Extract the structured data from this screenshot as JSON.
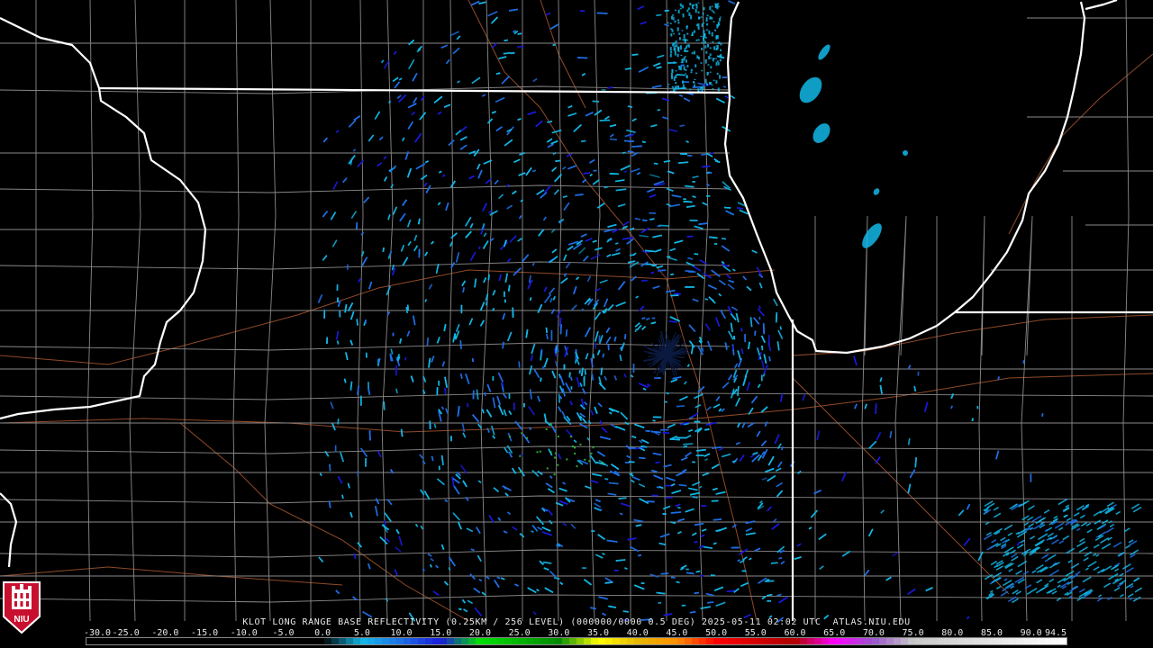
{
  "product": {
    "title": "KLOT LONG RANGE BASE REFLECTIVITY (0.25KM / 256 LEVEL) (000000/0000 0.5 DEG) 2025-05-11 02:02 UTC  ATLAS.NIU.EDU",
    "logo_text": "NIU"
  },
  "color_scale": {
    "labels": [
      "-30.0",
      "-25.0",
      "-20.0",
      "-15.0",
      "-10.0",
      "-5.0",
      "0.0",
      "5.0",
      "10.0",
      "15.0",
      "20.0",
      "25.0",
      "30.0",
      "35.0",
      "40.0",
      "45.0",
      "50.0",
      "55.0",
      "60.0",
      "65.0",
      "70.0",
      "75.0",
      "80.0",
      "85.0",
      "90.0",
      "94.5"
    ],
    "min": -30.0,
    "max": 94.5,
    "stops": [
      {
        "value": -30,
        "color": "#000000"
      },
      {
        "value": 0,
        "color": "#000000"
      },
      {
        "value": 5,
        "color": "#12b8e8"
      },
      {
        "value": 10,
        "color": "#1e6fe6"
      },
      {
        "value": 15,
        "color": "#1a1adb"
      },
      {
        "value": 20,
        "color": "#00e000"
      },
      {
        "value": 25,
        "color": "#00b400"
      },
      {
        "value": 30,
        "color": "#008a00"
      },
      {
        "value": 35,
        "color": "#ffff00"
      },
      {
        "value": 40,
        "color": "#e6b800"
      },
      {
        "value": 45,
        "color": "#ff9000"
      },
      {
        "value": 50,
        "color": "#ff0000"
      },
      {
        "value": 55,
        "color": "#d40000"
      },
      {
        "value": 60,
        "color": "#b00000"
      },
      {
        "value": 65,
        "color": "#ff00ff"
      },
      {
        "value": 70,
        "color": "#9955cc"
      },
      {
        "value": 75,
        "color": "#c8c8c8"
      },
      {
        "value": 94.5,
        "color": "#ffffff"
      }
    ]
  },
  "map": {
    "radar_site": "KLOT",
    "colors": {
      "state_border": "#ffffff",
      "county_border": "#8a8a8a",
      "highway": "#a0522d",
      "echo_light": "#12b8e8",
      "echo_mid": "#1e6fe6",
      "echo_dark": "#1a1adb",
      "echo_green": "#2fbf3a"
    }
  }
}
